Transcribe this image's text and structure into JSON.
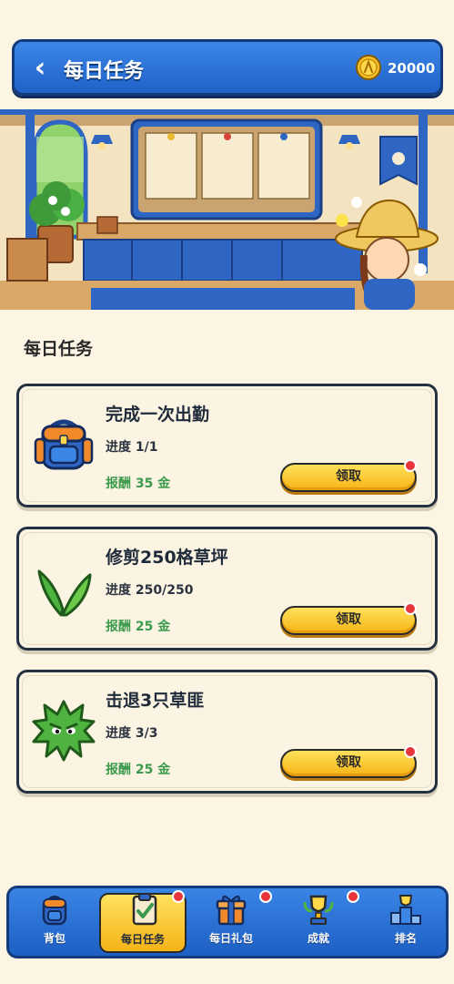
{
  "header": {
    "back_label": "‹",
    "title": "每日任务",
    "coins": "20000"
  },
  "section": {
    "title": "每日任务"
  },
  "tasks": [
    {
      "name": "完成一次出勤",
      "progress": "进度 1/1",
      "reward": "报酬 35 金",
      "claim_label": "领取",
      "icon": "backpack-icon"
    },
    {
      "name": "修剪250格草坪",
      "progress": "进度 250/250",
      "reward": "报酬 25 金",
      "claim_label": "领取",
      "icon": "grass-icon"
    },
    {
      "name": "击退3只草匪",
      "progress": "进度 3/3",
      "reward": "报酬 25 金",
      "claim_label": "领取",
      "icon": "weed-monster-icon"
    }
  ],
  "nav": {
    "items": [
      {
        "label": "背包",
        "icon": "backpack-icon"
      },
      {
        "label": "每日任务",
        "icon": "clipboard-check-icon"
      },
      {
        "label": "每日礼包",
        "icon": "gift-icon"
      },
      {
        "label": "成就",
        "icon": "trophy-laurel-icon"
      },
      {
        "label": "排名",
        "icon": "podium-icon"
      }
    ],
    "active": "每日任务"
  },
  "colors": {
    "primary_blue": "#1f62c8",
    "button_yellow": "#f6b415",
    "reward_green": "#3c9a4d",
    "notify_red": "#e8343b",
    "background": "#fcf5e4"
  }
}
